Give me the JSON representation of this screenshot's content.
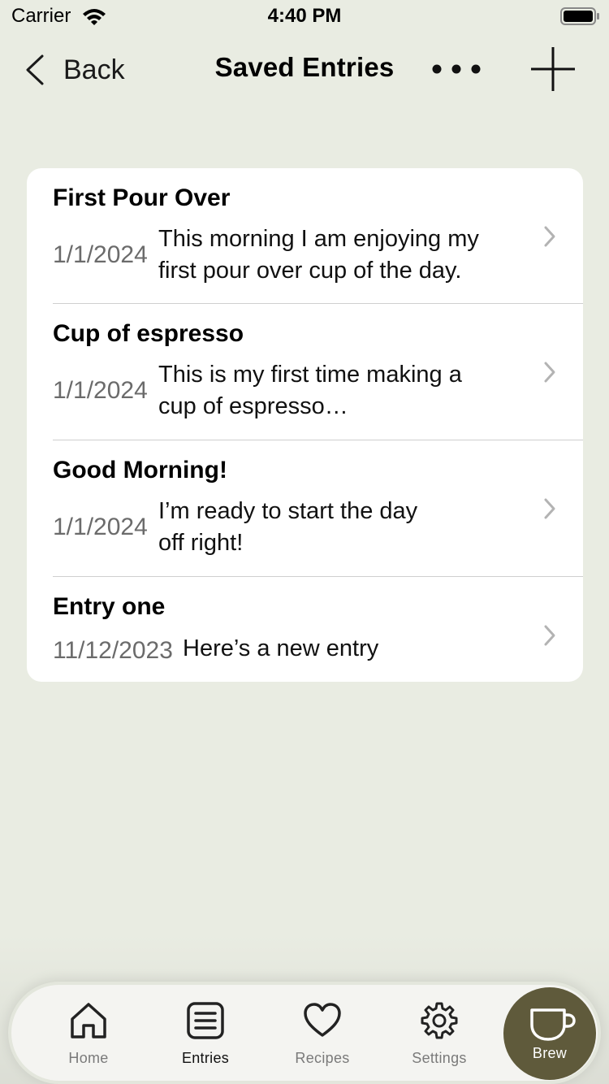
{
  "status_bar": {
    "carrier": "Carrier",
    "time": "4:40 PM"
  },
  "nav": {
    "back_label": "Back",
    "title": "Saved Entries"
  },
  "entries": [
    {
      "title": "First Pour Over",
      "date": "1/1/2024",
      "line1": "This morning I am enjoying my",
      "line2": "first pour over cup of the day."
    },
    {
      "title": "Cup of espresso",
      "date": "1/1/2024",
      "line1": "This is my first time making a",
      "line2": "cup of espresso…"
    },
    {
      "title": "Good Morning!",
      "date": "1/1/2024",
      "line1": "I’m ready to start the day",
      "line2": "off right!"
    },
    {
      "title": "Entry one",
      "date": "11/12/2023",
      "line1": "Here’s a new entry"
    }
  ],
  "tabs": [
    {
      "label": "Home",
      "icon": "house-icon",
      "active": false
    },
    {
      "label": "Entries",
      "icon": "list-icon",
      "active": true
    },
    {
      "label": "Recipes",
      "icon": "heart-icon",
      "active": false
    },
    {
      "label": "Settings",
      "icon": "gear-icon",
      "active": false
    }
  ],
  "brew": {
    "label": "Brew",
    "icon": "cup-icon"
  },
  "colors": {
    "background": "#e9ece2",
    "brew_accent": "#5f5a3b",
    "card": "#ffffff"
  }
}
